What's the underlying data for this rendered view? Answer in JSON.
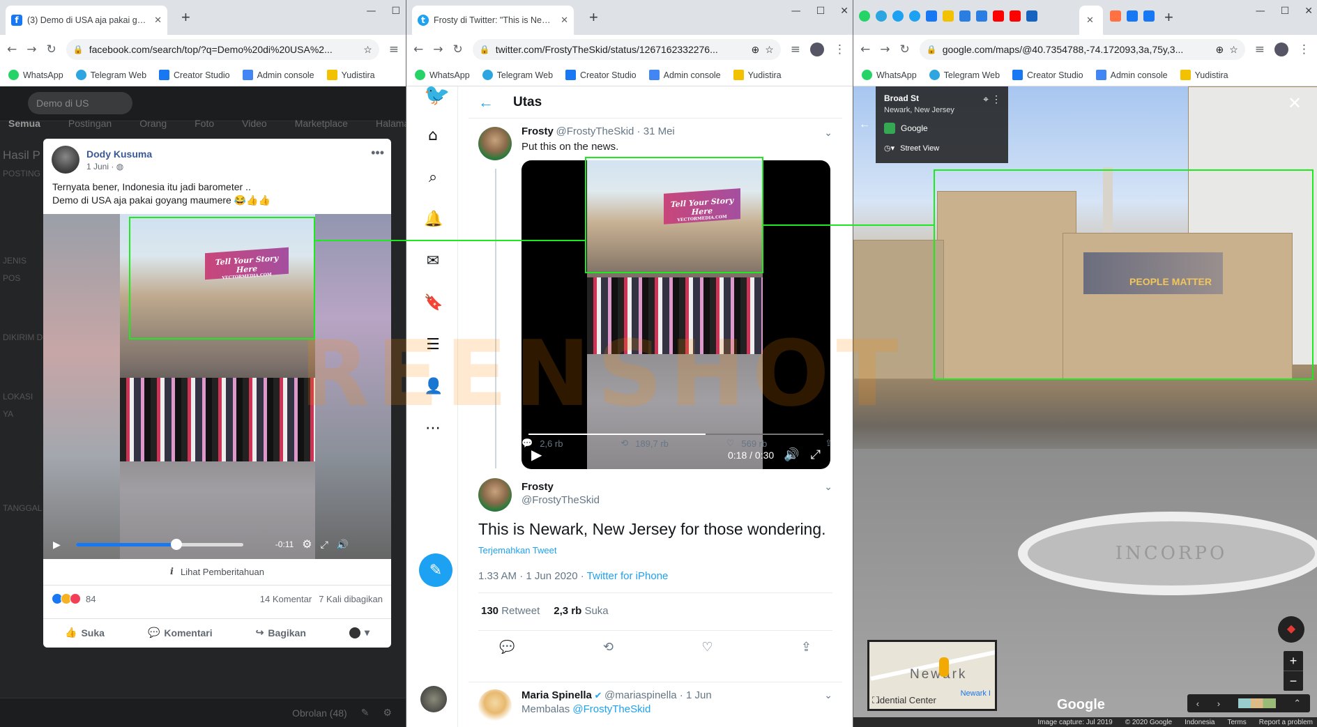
{
  "facebook": {
    "tab_title": "(3) Demo di USA aja pakai goyang",
    "url": "facebook.com/search/top/?q=Demo%20di%20USA%2...",
    "search_value": "Demo di US",
    "nav": [
      "Semua",
      "Postingan",
      "Orang",
      "Foto",
      "Video",
      "Marketplace",
      "Halaman"
    ],
    "side": [
      "POSTING",
      "JENIS POS",
      "DIKIRIM D",
      "LOKASI YA",
      "TANGGAL"
    ],
    "results_label": "Hasil P",
    "post": {
      "author": "Dody Kusuma",
      "date": "1 Juni · ",
      "text": "Ternyata bener, Indonesia itu jadi barometer ..\nDemo di USA aja pakai goyang maumere 😂👍👍",
      "video_time": "-0:11",
      "video_progress": 0.6,
      "notice": "Lihat Pemberitahuan",
      "reactions": "84",
      "comments": "14 Komentar",
      "shares": "7 Kali dibagikan",
      "like": "Suka",
      "comment": "Komentari",
      "share": "Bagikan"
    },
    "footer_chat": "Obrolan (48)",
    "sign_text": "Tell Your Story Here",
    "sign_sub": "VECTORMEDIA.COM"
  },
  "twitter": {
    "tab_title": "Frosty di Twitter: \"This is Newark",
    "url": "twitter.com/FrostyTheSkid/status/1267162332276...",
    "header": "Utas",
    "tweet1": {
      "name": "Frosty",
      "handle": "@FrostyTheSkid · 31 Mei",
      "text": "Put this on the news.",
      "video_time": "0:18 / 0:30",
      "video_progress": 0.6,
      "replies": "2,6 rb",
      "retweets": "189,7 rb",
      "likes": "569 rb"
    },
    "tweet2": {
      "name": "Frosty",
      "handle": "@FrostyTheSkid",
      "text": "This is Newark, New Jersey for those wondering.",
      "translate": "Terjemahkan Tweet",
      "timestamp": "1.33 AM · 1 Jun 2020 · ",
      "client": "Twitter for iPhone",
      "rt_count": "130",
      "rt_label": "Retweet",
      "like_count": "2,3 rb",
      "like_label": "Suka"
    },
    "reply": {
      "name": "Maria Spinella",
      "handle": "@mariaspinella · 1 Jun",
      "replying": "Membalas ",
      "replying_to": "@FrostyTheSkid"
    }
  },
  "maps": {
    "url": "google.com/maps/@40.7354788,-74.172093,3a,75y,3...",
    "place": "Broad St",
    "city": "Newark, New Jersey",
    "source": "Google",
    "mode": "Street View",
    "minimap_label": "Newark",
    "minimap_street": "idential Center",
    "minimap_link": "Newark I",
    "logo": "Google",
    "footer": [
      "Image capture: Jul 2019",
      "© 2020 Google",
      "Indonesia",
      "Terms",
      "Report a problem"
    ],
    "seal_text": "INCORPO",
    "billboard": "PEOPLE MATTER"
  },
  "bookmarks": [
    "WhatsApp",
    "Telegram Web",
    "Creator Studio",
    "Admin console",
    "Yudistira"
  ],
  "watermark": "REENSHOT",
  "colors": {
    "fb_blue": "#1877f2",
    "twitter_blue": "#1da1f2",
    "highlight_green": "#1ee81e"
  }
}
